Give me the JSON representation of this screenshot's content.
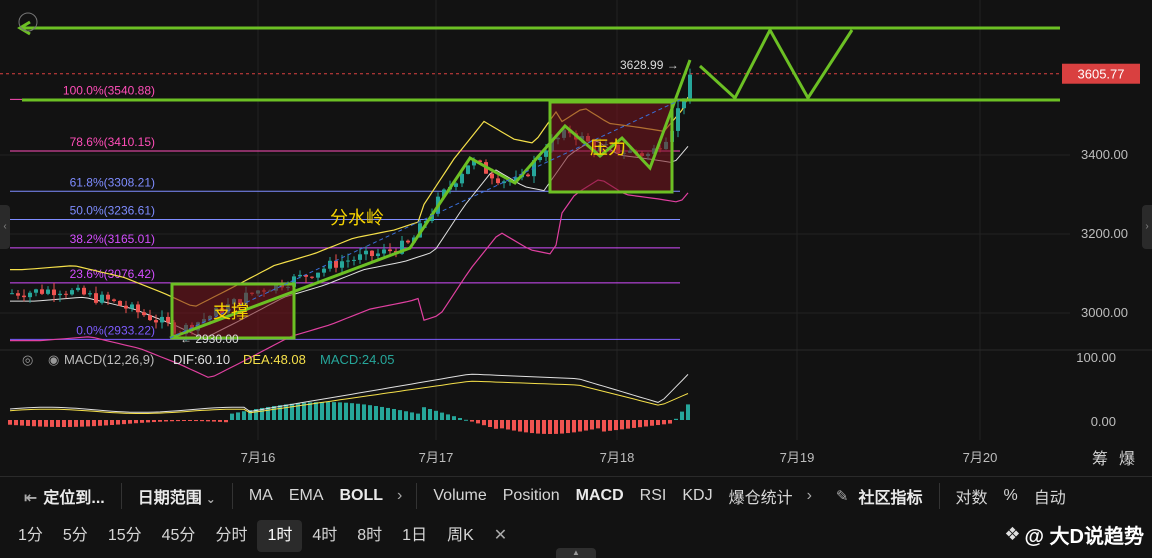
{
  "chart_data": {
    "type": "candlestick",
    "x_ticks": [
      "7月16",
      "7月17",
      "7月18",
      "7月19",
      "7月20"
    ],
    "y_ticks": [
      "3400.00",
      "3200.00",
      "3000.00"
    ],
    "price_current": "3605.77",
    "price_high_label": "3628.99",
    "price_low_label": "2930.00",
    "fib_levels": [
      {
        "label": "100.0%(3540.88)",
        "value": 3540.88,
        "color": "#ff4db8"
      },
      {
        "label": "78.6%(3410.15)",
        "value": 3410.15,
        "color": "#ff4db8"
      },
      {
        "label": "61.8%(3308.21)",
        "value": 3308.21,
        "color": "#7e8cff"
      },
      {
        "label": "50.0%(3236.61)",
        "value": 3236.61,
        "color": "#7e8cff"
      },
      {
        "label": "38.2%(3165.01)",
        "value": 3165.01,
        "color": "#d44dff"
      },
      {
        "label": "23.6%(3076.42)",
        "value": 3076.42,
        "color": "#d44dff"
      },
      {
        "label": "0.0%(2933.22)",
        "value": 2933.22,
        "color": "#7e5cff"
      }
    ],
    "annotations": {
      "support": "支撑",
      "watershed": "分水岭",
      "pressure": "压力"
    },
    "macd": {
      "title": "MACD(12,26,9)",
      "dif": "DIF:60.10",
      "dea": "DEA:48.08",
      "macd": "MACD:24.05",
      "y_ticks": [
        "100.00",
        "0.00"
      ]
    },
    "right_labels": {
      "chips": "筹",
      "burst": "爆"
    },
    "colors": {
      "up": "#26a69a",
      "down": "#ef5350",
      "green_draw": "#6cc024",
      "mid_band": "#e0e0e0",
      "upper_band": "#f5e04a",
      "lower_band": "#e040a0",
      "current_price": "#d94040"
    }
  },
  "toolbar1": {
    "locate": "定位到...",
    "date_range": "日期范围",
    "ma": "MA",
    "ema": "EMA",
    "boll": "BOLL",
    "volume": "Volume",
    "position": "Position",
    "macd": "MACD",
    "rsi": "RSI",
    "kdj": "KDJ",
    "liq": "爆仓统计",
    "community": "社区指标",
    "log": "对数",
    "pct": "%",
    "auto": "自动"
  },
  "toolbar2": {
    "timeframes": [
      "1分",
      "5分",
      "15分",
      "45分",
      "分时",
      "1时",
      "4时",
      "8时",
      "1日",
      "周K"
    ],
    "active": "1时"
  },
  "brand": "@ 大D说趋势"
}
